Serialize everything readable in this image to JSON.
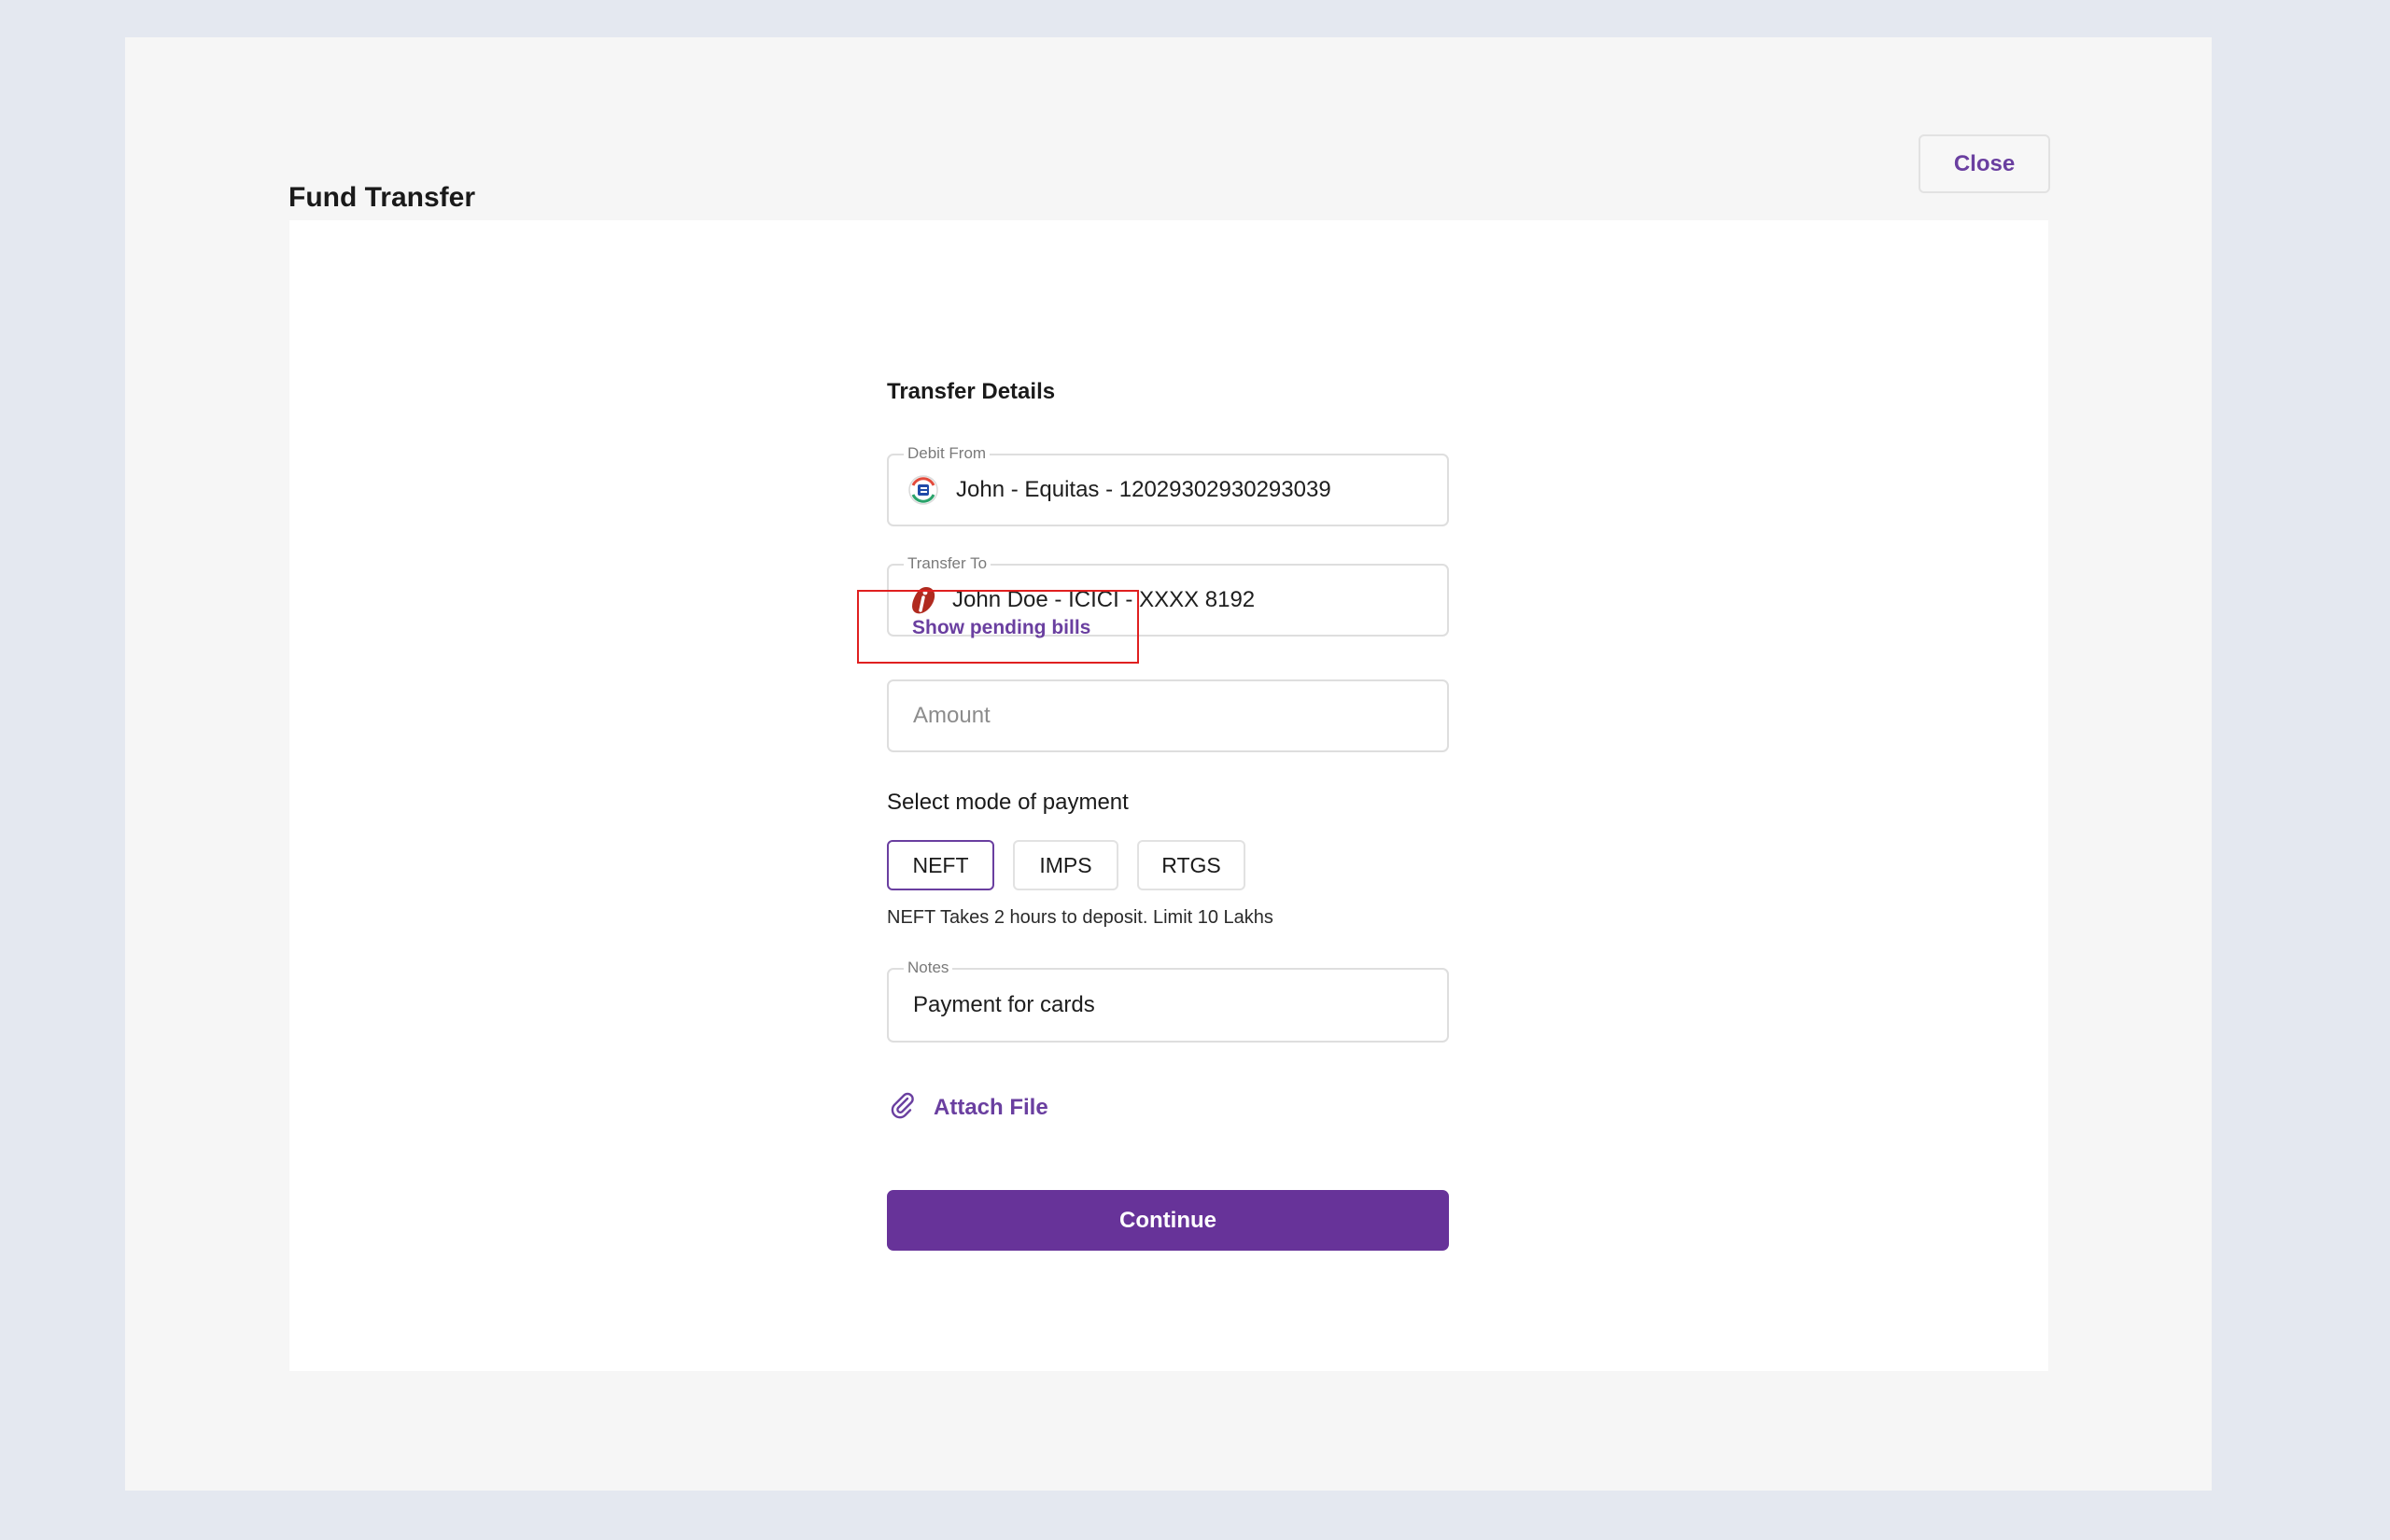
{
  "modal": {
    "title": "Fund Transfer",
    "close_label": "Close"
  },
  "form": {
    "section_title": "Transfer Details",
    "debit_from": {
      "label": "Debit From",
      "value": "John - Equitas - 12029302930293039",
      "icon": "equitas-bank-icon"
    },
    "transfer_to": {
      "label": "Transfer To",
      "value": "John Doe - ICICI - XXXX 8192",
      "icon": "icici-bank-icon"
    },
    "pending_bills_label": "Show pending bills",
    "amount": {
      "placeholder": "Amount",
      "value": ""
    },
    "payment_mode": {
      "label": "Select mode of payment",
      "options": [
        "NEFT",
        "IMPS",
        "RTGS"
      ],
      "selected": "NEFT",
      "note": "NEFT Takes 2 hours to deposit. Limit 10 Lakhs"
    },
    "notes": {
      "label": "Notes",
      "value": "Payment for cards"
    },
    "attach_label": "Attach File",
    "continue_label": "Continue"
  },
  "colors": {
    "accent": "#6a3fa0",
    "primary_button": "#673399",
    "highlight_border": "#e02020",
    "page_background": "#e4e8f0"
  }
}
